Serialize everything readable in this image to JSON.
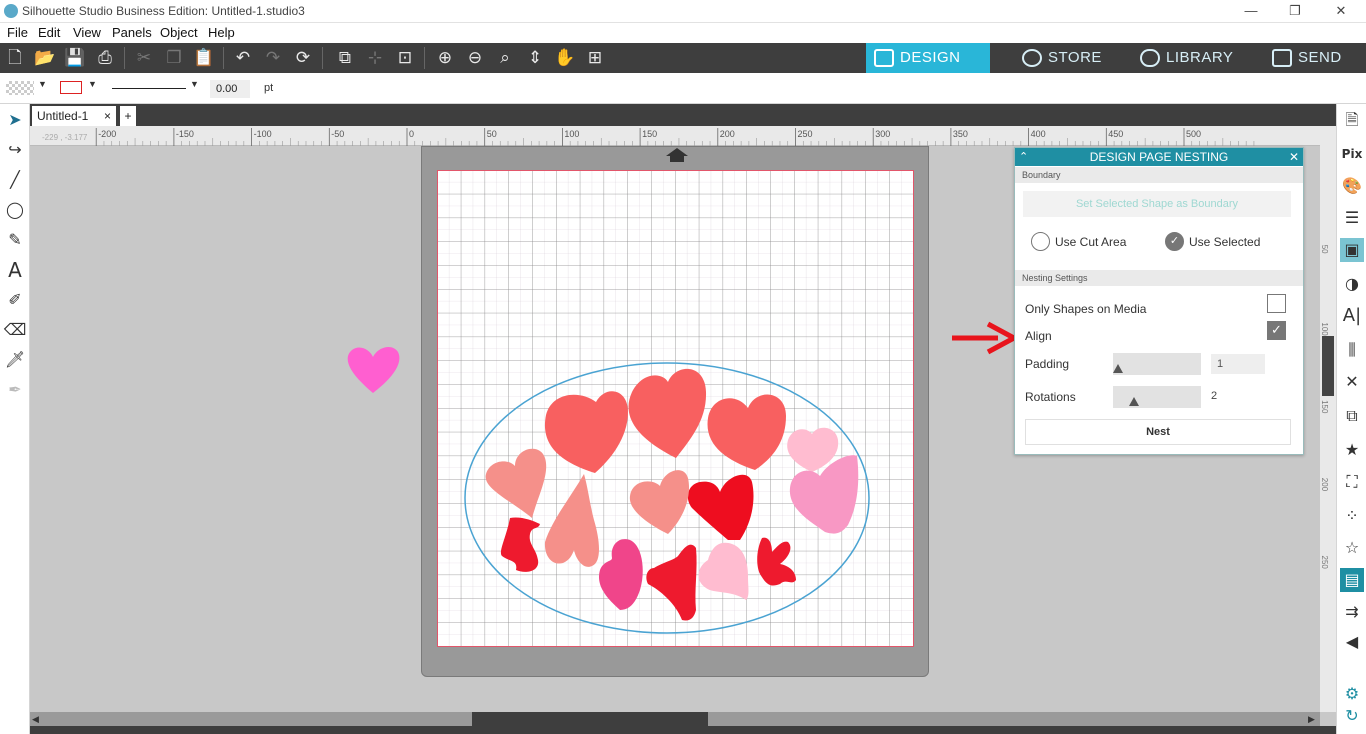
{
  "window": {
    "title": "Silhouette Studio Business Edition: Untitled-1.studio3",
    "min": "—",
    "max": "❐",
    "close": "✕"
  },
  "menu": [
    "File",
    "Edit",
    "View",
    "Panels",
    "Object",
    "Help"
  ],
  "nav_tabs": [
    {
      "label": "DESIGN",
      "active": true
    },
    {
      "label": "STORE",
      "active": false
    },
    {
      "label": "LIBRARY",
      "active": false
    },
    {
      "label": "SEND",
      "active": false
    }
  ],
  "props": {
    "line_width": "0.00",
    "unit": "pt"
  },
  "doc_tab": {
    "name": "Untitled-1",
    "close": "×",
    "add": "+"
  },
  "ruler": {
    "coord": "-229 , -3.177",
    "h_ticks": [
      "-200",
      "-150",
      "-100",
      "-50",
      "0",
      "50",
      "100",
      "150",
      "200",
      "250",
      "300",
      "350",
      "400",
      "450",
      "500"
    ],
    "v_ticks": [
      "50",
      "100",
      "150",
      "200",
      "250"
    ]
  },
  "nesting_panel": {
    "title": "DESIGN PAGE NESTING",
    "boundary_section": "Boundary",
    "set_boundary_button": "Set Selected Shape as Boundary",
    "use_cut_area": "Use Cut Area",
    "use_selected": "Use Selected",
    "nesting_section": "Nesting Settings",
    "only_shapes": "Only Shapes on Media",
    "only_shapes_checked": false,
    "align": "Align",
    "align_checked": true,
    "padding_label": "Padding",
    "padding_value": "1",
    "padding_level": 0.0,
    "rotations_label": "Rotations",
    "rotations_value": "2",
    "rotations_level": 0.2,
    "nest_button": "Nest"
  },
  "colors": {
    "accent": "#1f8fa3",
    "toolbar": "#3e3e3e",
    "arrow": "#e8141c"
  }
}
